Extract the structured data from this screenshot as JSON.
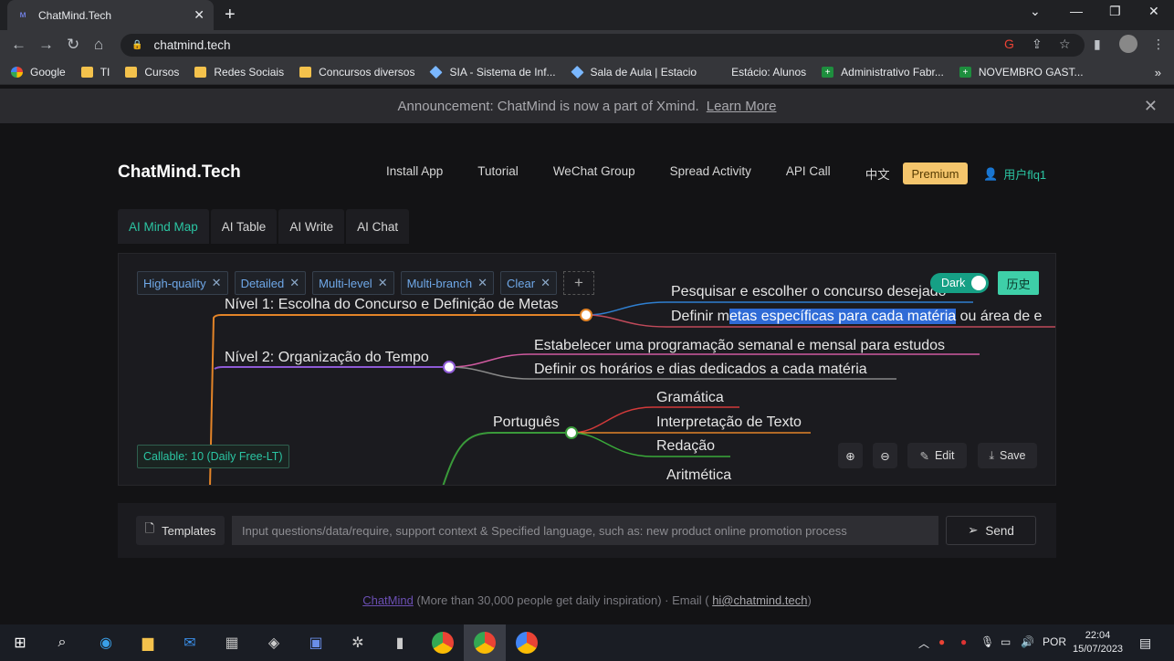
{
  "browser": {
    "tab_title": "ChatMind.Tech",
    "url": "chatmind.tech",
    "bookmarks": [
      {
        "label": "Google",
        "kind": "circ"
      },
      {
        "label": "TI",
        "kind": "folder"
      },
      {
        "label": "Cursos",
        "kind": "folder"
      },
      {
        "label": "Redes Sociais",
        "kind": "folder"
      },
      {
        "label": "Concursos diversos",
        "kind": "folder"
      },
      {
        "label": "SIA - Sistema de Inf...",
        "kind": "diamond"
      },
      {
        "label": "Sala de Aula | Estacio",
        "kind": "diamond"
      },
      {
        "label": "Estácio: Alunos",
        "kind": "none"
      },
      {
        "label": "Administrativo Fabr...",
        "kind": "green"
      },
      {
        "label": "NOVEMBRO GAST...",
        "kind": "green"
      }
    ]
  },
  "announcement": {
    "text": "Announcement: ChatMind is now a part of Xmind.",
    "link": "Learn More"
  },
  "header": {
    "logo": "ChatMind.Tech",
    "nav": [
      "Install App",
      "Tutorial",
      "WeChat Group",
      "Spread Activity",
      "API Call",
      "中文"
    ],
    "premium": "Premium",
    "user": "用户flq1"
  },
  "mode_tabs": [
    "AI Mind Map",
    "AI Table",
    "AI Write",
    "AI Chat"
  ],
  "chips": [
    "High-quality",
    "Detailed",
    "Multi-level",
    "Multi-branch",
    "Clear"
  ],
  "toggle": {
    "label": "Dark",
    "history": "历史"
  },
  "mindmap": {
    "level1": "Nível 1: Escolha do Concurso e Definição de Metas",
    "level1_children": [
      "Pesquisar e escolher o concurso desejado",
      "Definir m",
      "etas específicas para cada matéria",
      " ou área de e"
    ],
    "level2": "Nível 2: Organização do Tempo",
    "level2_children": [
      "Estabelecer uma programação semanal e mensal para estudos",
      "Definir os horários e dias dedicados a cada matéria"
    ],
    "portugues": "Português",
    "portugues_children": [
      "Gramática",
      "Interpretação de Texto",
      "Redação"
    ],
    "aritmetica": "Aritmética"
  },
  "callable": "Callable: 10 (Daily Free-LT)",
  "controls": {
    "edit": "Edit",
    "save": "Save"
  },
  "input": {
    "templates": "Templates",
    "placeholder": "Input questions/data/require, support context & Specified language, such as: new product online promotion process",
    "send": "Send"
  },
  "footer": {
    "brand": "ChatMind",
    "text": " (More than 30,000 people get daily inspiration) · Email ( ",
    "email": "hi@chatmind.tech",
    "end": ")"
  },
  "taskbar": {
    "lang": "POR",
    "time": "22:04",
    "date": "15/07/2023"
  }
}
